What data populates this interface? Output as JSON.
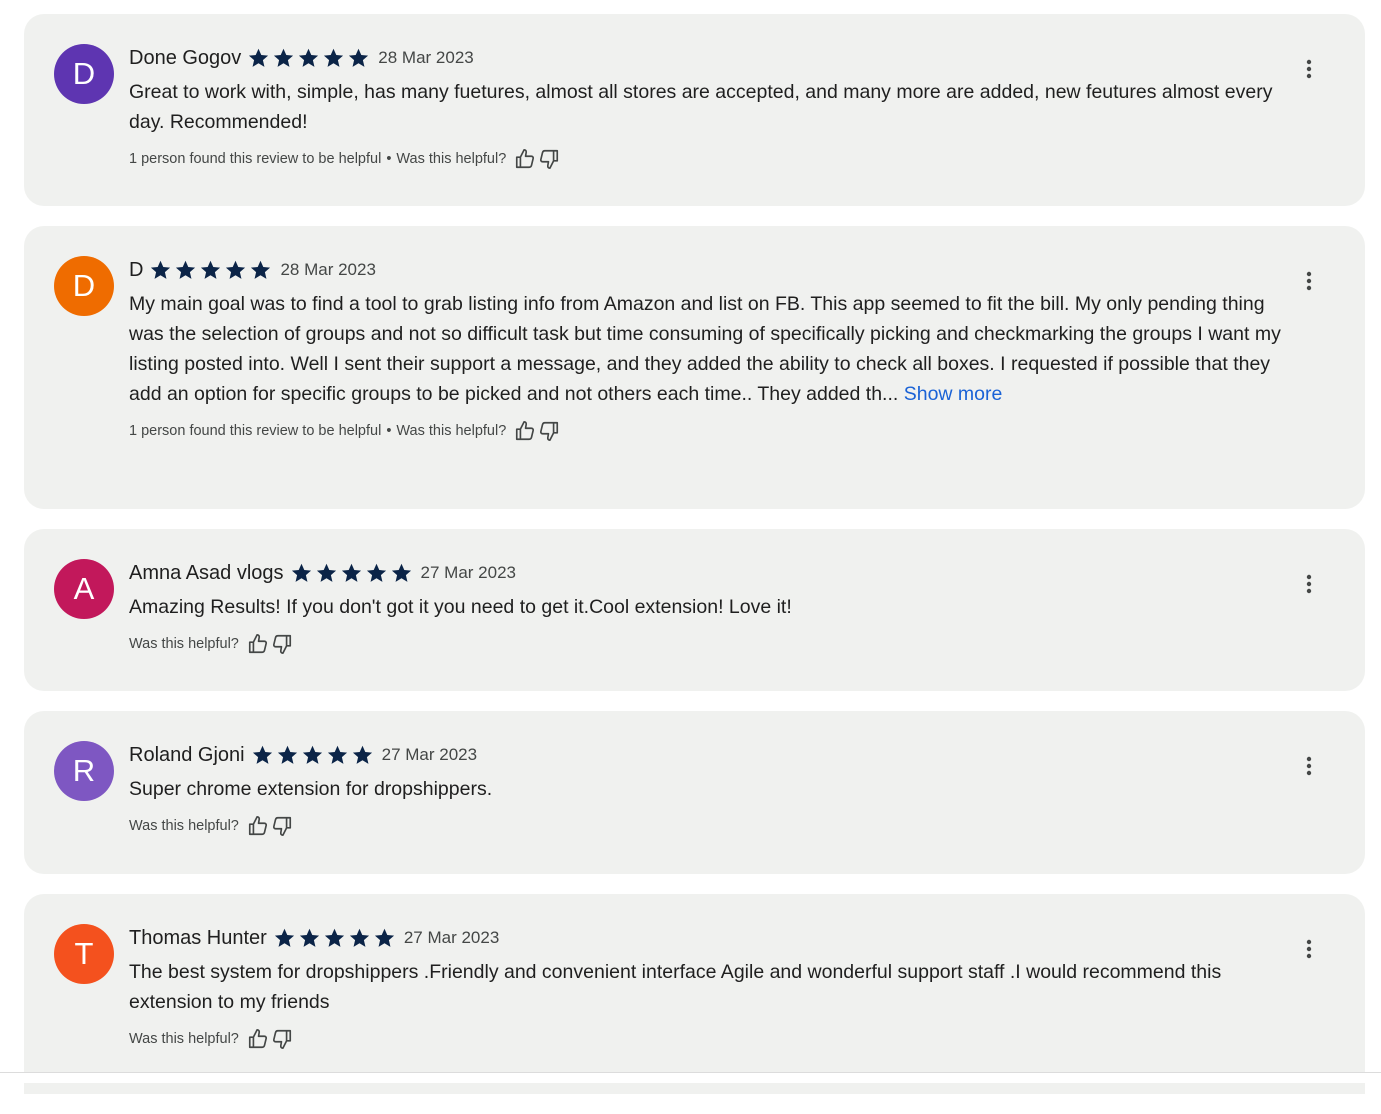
{
  "colors": {
    "card_background": "#f0f1ef",
    "star": "#0b2447",
    "link": "#1a62d6"
  },
  "reviews": [
    {
      "initial": "D",
      "avatar_color": "#5e35b1",
      "name": "Done Gogov",
      "rating": 5,
      "date": "28 Mar 2023",
      "text": "Great to work with, simple, has many fuetures, almost all stores are accepted, and many more are added, new feutures almost every day. Recommended!",
      "show_more": "",
      "helpful_count_text": "1 person found this review to be helpful",
      "separator": "•",
      "helpful_prompt": "Was this helpful?"
    },
    {
      "initial": "D",
      "avatar_color": "#ef6c00",
      "name": "D",
      "rating": 5,
      "date": "28 Mar 2023",
      "text": "My main goal was to find a tool to grab listing info from Amazon and list on FB. This app seemed to fit the bill. My only pending thing was the selection of groups and not so difficult task but time consuming of specifically picking and checkmarking the groups I want my listing posted into. Well I sent their support a message, and they added the ability to check all boxes. I requested if possible that they add an option for specific groups to be picked and not others each time.. They added th...",
      "show_more": "Show more",
      "helpful_count_text": "1 person found this review to be helpful",
      "separator": "•",
      "helpful_prompt": "Was this helpful?"
    },
    {
      "initial": "A",
      "avatar_color": "#c2185b",
      "name": "Amna Asad vlogs",
      "rating": 5,
      "date": "27 Mar 2023",
      "text": "Amazing Results! If you don't got it you need to get it.Cool extension! Love it!",
      "show_more": "",
      "helpful_count_text": "",
      "separator": "",
      "helpful_prompt": "Was this helpful?"
    },
    {
      "initial": "R",
      "avatar_color": "#7e57c2",
      "name": "Roland Gjoni",
      "rating": 5,
      "date": "27 Mar 2023",
      "text": "Super chrome extension for dropshippers.",
      "show_more": "",
      "helpful_count_text": "",
      "separator": "",
      "helpful_prompt": "Was this helpful?"
    },
    {
      "initial": "T",
      "avatar_color": "#f4511e",
      "name": "Thomas Hunter",
      "rating": 5,
      "date": "27 Mar 2023",
      "text": "The best system for dropshippers .Friendly and convenient interface Agile and wonderful support staff .I would recommend this extension to my friends",
      "show_more": "",
      "helpful_count_text": "",
      "separator": "",
      "helpful_prompt": "Was this helpful?"
    }
  ]
}
